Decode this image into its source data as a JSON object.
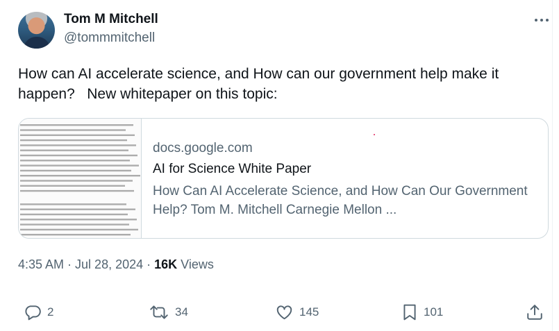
{
  "author": {
    "display_name": "Tom M Mitchell",
    "handle": "@tommmitchell"
  },
  "tweet": {
    "text": "How can AI accelerate science, and How can our government help make it happen?   New whitepaper on this topic:"
  },
  "card": {
    "domain": "docs.google.com",
    "title": "AI for Science White Paper",
    "description": "How Can AI Accelerate Science, and How Can Our Government Help? Tom M. Mitchell Carnegie Mellon ..."
  },
  "meta": {
    "time": "4:35 AM",
    "separator": " · ",
    "date": "Jul 28, 2024",
    "views_count": "16K",
    "views_label": " Views"
  },
  "actions": {
    "replies": "2",
    "reposts": "34",
    "likes": "145",
    "bookmarks": "101"
  },
  "icons": [
    "more-icon",
    "reply-icon",
    "repost-icon",
    "like-icon",
    "bookmark-icon",
    "share-icon"
  ]
}
